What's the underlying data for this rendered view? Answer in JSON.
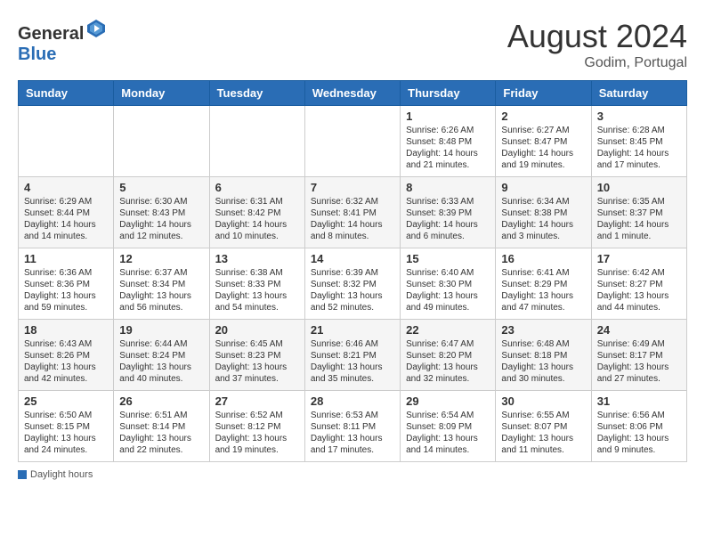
{
  "header": {
    "logo_general": "General",
    "logo_blue": "Blue",
    "month_year": "August 2024",
    "location": "Godim, Portugal"
  },
  "calendar": {
    "weekdays": [
      "Sunday",
      "Monday",
      "Tuesday",
      "Wednesday",
      "Thursday",
      "Friday",
      "Saturday"
    ],
    "weeks": [
      [
        {
          "day": "",
          "info": ""
        },
        {
          "day": "",
          "info": ""
        },
        {
          "day": "",
          "info": ""
        },
        {
          "day": "",
          "info": ""
        },
        {
          "day": "1",
          "info": "Sunrise: 6:26 AM\nSunset: 8:48 PM\nDaylight: 14 hours and 21 minutes."
        },
        {
          "day": "2",
          "info": "Sunrise: 6:27 AM\nSunset: 8:47 PM\nDaylight: 14 hours and 19 minutes."
        },
        {
          "day": "3",
          "info": "Sunrise: 6:28 AM\nSunset: 8:45 PM\nDaylight: 14 hours and 17 minutes."
        }
      ],
      [
        {
          "day": "4",
          "info": "Sunrise: 6:29 AM\nSunset: 8:44 PM\nDaylight: 14 hours and 14 minutes."
        },
        {
          "day": "5",
          "info": "Sunrise: 6:30 AM\nSunset: 8:43 PM\nDaylight: 14 hours and 12 minutes."
        },
        {
          "day": "6",
          "info": "Sunrise: 6:31 AM\nSunset: 8:42 PM\nDaylight: 14 hours and 10 minutes."
        },
        {
          "day": "7",
          "info": "Sunrise: 6:32 AM\nSunset: 8:41 PM\nDaylight: 14 hours and 8 minutes."
        },
        {
          "day": "8",
          "info": "Sunrise: 6:33 AM\nSunset: 8:39 PM\nDaylight: 14 hours and 6 minutes."
        },
        {
          "day": "9",
          "info": "Sunrise: 6:34 AM\nSunset: 8:38 PM\nDaylight: 14 hours and 3 minutes."
        },
        {
          "day": "10",
          "info": "Sunrise: 6:35 AM\nSunset: 8:37 PM\nDaylight: 14 hours and 1 minute."
        }
      ],
      [
        {
          "day": "11",
          "info": "Sunrise: 6:36 AM\nSunset: 8:36 PM\nDaylight: 13 hours and 59 minutes."
        },
        {
          "day": "12",
          "info": "Sunrise: 6:37 AM\nSunset: 8:34 PM\nDaylight: 13 hours and 56 minutes."
        },
        {
          "day": "13",
          "info": "Sunrise: 6:38 AM\nSunset: 8:33 PM\nDaylight: 13 hours and 54 minutes."
        },
        {
          "day": "14",
          "info": "Sunrise: 6:39 AM\nSunset: 8:32 PM\nDaylight: 13 hours and 52 minutes."
        },
        {
          "day": "15",
          "info": "Sunrise: 6:40 AM\nSunset: 8:30 PM\nDaylight: 13 hours and 49 minutes."
        },
        {
          "day": "16",
          "info": "Sunrise: 6:41 AM\nSunset: 8:29 PM\nDaylight: 13 hours and 47 minutes."
        },
        {
          "day": "17",
          "info": "Sunrise: 6:42 AM\nSunset: 8:27 PM\nDaylight: 13 hours and 44 minutes."
        }
      ],
      [
        {
          "day": "18",
          "info": "Sunrise: 6:43 AM\nSunset: 8:26 PM\nDaylight: 13 hours and 42 minutes."
        },
        {
          "day": "19",
          "info": "Sunrise: 6:44 AM\nSunset: 8:24 PM\nDaylight: 13 hours and 40 minutes."
        },
        {
          "day": "20",
          "info": "Sunrise: 6:45 AM\nSunset: 8:23 PM\nDaylight: 13 hours and 37 minutes."
        },
        {
          "day": "21",
          "info": "Sunrise: 6:46 AM\nSunset: 8:21 PM\nDaylight: 13 hours and 35 minutes."
        },
        {
          "day": "22",
          "info": "Sunrise: 6:47 AM\nSunset: 8:20 PM\nDaylight: 13 hours and 32 minutes."
        },
        {
          "day": "23",
          "info": "Sunrise: 6:48 AM\nSunset: 8:18 PM\nDaylight: 13 hours and 30 minutes."
        },
        {
          "day": "24",
          "info": "Sunrise: 6:49 AM\nSunset: 8:17 PM\nDaylight: 13 hours and 27 minutes."
        }
      ],
      [
        {
          "day": "25",
          "info": "Sunrise: 6:50 AM\nSunset: 8:15 PM\nDaylight: 13 hours and 24 minutes."
        },
        {
          "day": "26",
          "info": "Sunrise: 6:51 AM\nSunset: 8:14 PM\nDaylight: 13 hours and 22 minutes."
        },
        {
          "day": "27",
          "info": "Sunrise: 6:52 AM\nSunset: 8:12 PM\nDaylight: 13 hours and 19 minutes."
        },
        {
          "day": "28",
          "info": "Sunrise: 6:53 AM\nSunset: 8:11 PM\nDaylight: 13 hours and 17 minutes."
        },
        {
          "day": "29",
          "info": "Sunrise: 6:54 AM\nSunset: 8:09 PM\nDaylight: 13 hours and 14 minutes."
        },
        {
          "day": "30",
          "info": "Sunrise: 6:55 AM\nSunset: 8:07 PM\nDaylight: 13 hours and 11 minutes."
        },
        {
          "day": "31",
          "info": "Sunrise: 6:56 AM\nSunset: 8:06 PM\nDaylight: 13 hours and 9 minutes."
        }
      ]
    ]
  },
  "legend": {
    "daylight_hours": "Daylight hours"
  }
}
